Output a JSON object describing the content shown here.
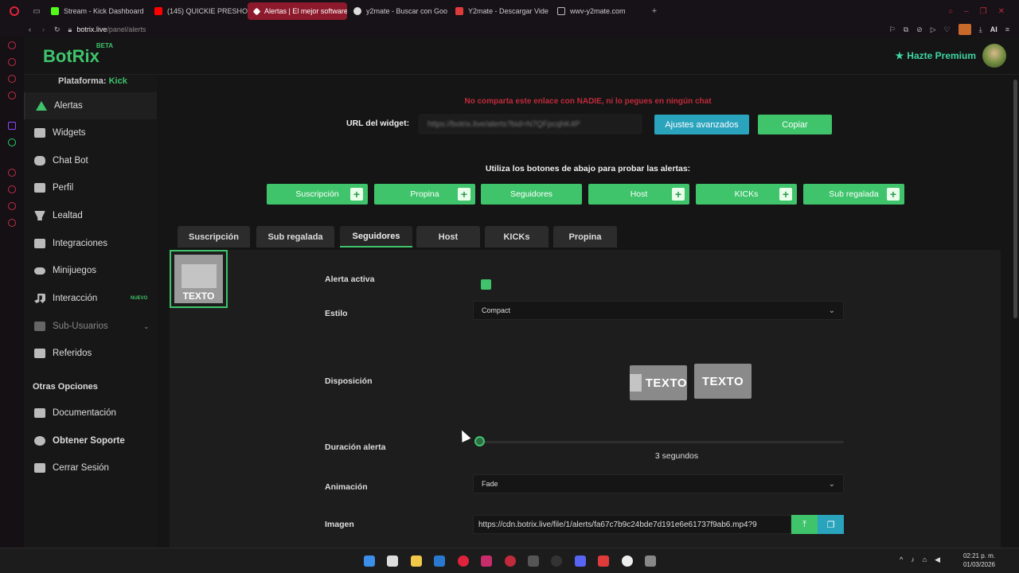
{
  "browser": {
    "tabs": [
      {
        "label": "Stream - Kick Dashboard",
        "color": "#53fc18"
      },
      {
        "label": "(145) QUICKIE PRESHOW",
        "color": "#ff0000"
      },
      {
        "label": "Alertas | El mejor software",
        "color": "#c02a3b",
        "active": true
      },
      {
        "label": "y2mate - Buscar con Goo",
        "color": "#dddddd"
      },
      {
        "label": "Y2mate - Descargar Vide",
        "color": "#e03b3b"
      },
      {
        "label": "wwv-y2mate.com",
        "color": "#bbbbbb"
      }
    ],
    "url_host": "botrix.live",
    "url_path": "/panel/alerts"
  },
  "header": {
    "logo": "BotRix",
    "logo_tag": "BETA",
    "premium_label": "Hazte Premium"
  },
  "sidebar": {
    "platform_label": "Plataforma:",
    "platform_value": "Kick",
    "items": [
      {
        "label": "Alertas",
        "icon": "warning-icon"
      },
      {
        "label": "Widgets",
        "icon": "grid-icon"
      },
      {
        "label": "Chat Bot",
        "icon": "robot-icon"
      },
      {
        "label": "Perfil",
        "icon": "id-card-icon"
      },
      {
        "label": "Lealtad",
        "icon": "trophy-icon"
      },
      {
        "label": "Integraciones",
        "icon": "plug-icon"
      },
      {
        "label": "Minijuegos",
        "icon": "gamepad-icon"
      },
      {
        "label": "Interacción",
        "icon": "music-icon",
        "badge": "NUEVO"
      },
      {
        "label": "Sub-Usuarios",
        "icon": "users-icon"
      },
      {
        "label": "Referidos",
        "icon": "user-group-icon"
      }
    ],
    "other_title": "Otras Opciones",
    "other_items": [
      {
        "label": "Documentación",
        "icon": "book-icon"
      },
      {
        "label": "Obtener Soporte",
        "icon": "help-icon"
      },
      {
        "label": "Cerrar Sesión",
        "icon": "logout-icon"
      }
    ]
  },
  "widget": {
    "warning": "No comparta este enlace con NADIE, ni lo pegues en ningún chat",
    "url_label": "URL del widget:",
    "url_value": "https://botrix.live/alerts?bid=N7QFpcqhK4P",
    "advanced_button": "Ajustes avanzados",
    "copy_button": "Copiar"
  },
  "test": {
    "label": "Utiliza los botones de abajo para probar las alertas:",
    "buttons": [
      "Suscripción",
      "Propina",
      "Seguidores",
      "Host",
      "KICKs",
      "Sub regalada"
    ]
  },
  "alert_tabs": [
    "Suscripción",
    "Sub regalada",
    "Seguidores",
    "Host",
    "KICKs",
    "Propina"
  ],
  "form": {
    "active_label": "Alerta activa",
    "active_checked": true,
    "style_label": "Estilo",
    "style_value": "Compact",
    "layout_label": "Disposición",
    "layout_text": "TEXTO",
    "duration_label": "Duración alerta",
    "duration_value": "3 segundos",
    "duration_seconds": 3,
    "animation_label": "Animación",
    "animation_value": "Fade",
    "image_label": "Imagen",
    "image_value": "https://cdn.botrix.live/file/1/alerts/fa67c7b9c24bde7d191e6e61737f9ab6.mp4?9"
  },
  "taskbar": {
    "time": "02:21 p. m.",
    "date": "01/03/2026"
  },
  "colors": {
    "accent": "#3fc46b",
    "info": "#2aa3bd",
    "danger": "#c02a3b"
  }
}
